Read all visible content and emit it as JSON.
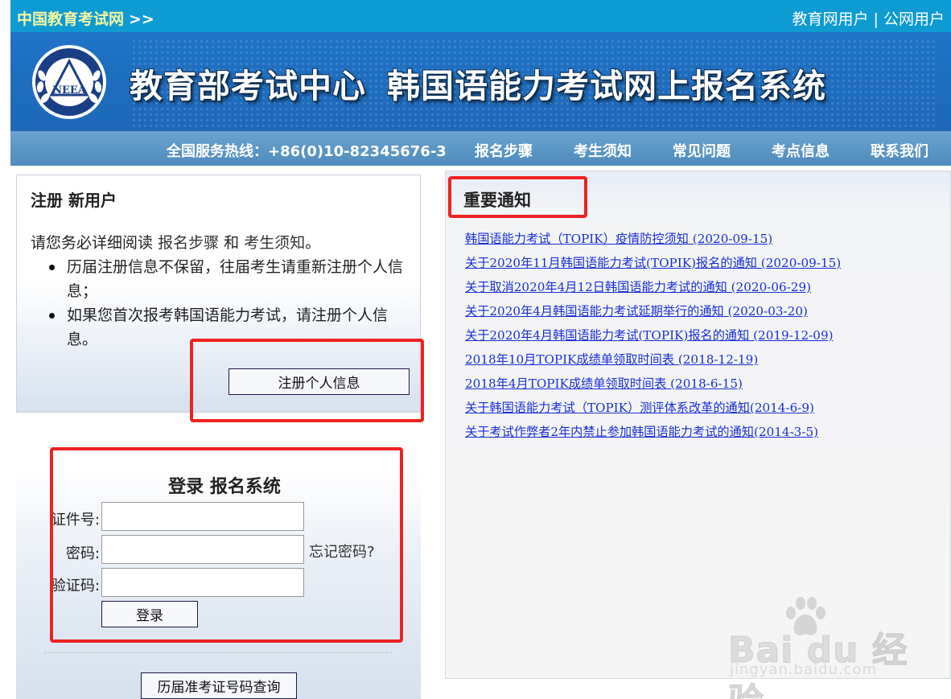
{
  "topbar": {
    "site_name": "中国教育考试网",
    "site_arrow": ">>",
    "user_link_edu": "教育网用户",
    "separator": "|",
    "user_link_public": "公网用户"
  },
  "banner": {
    "logo_text": "NEEA",
    "title_part1": "教育部考试中心",
    "title_part2": "韩国语能力考试网上报名系统"
  },
  "nav": {
    "hotline": "全国服务热线：+86(0)10-82345676-3",
    "items": [
      "报名步骤",
      "考生须知",
      "常见问题",
      "考点信息",
      "联系我们"
    ]
  },
  "register": {
    "title": "注册 新用户",
    "intro_prefix": "请您务必详细阅读",
    "link_steps": "报名步骤",
    "and": "和",
    "link_notice": "考生须知",
    "intro_suffix": "。",
    "bullets": [
      "历届注册信息不保留，往届考生请重新注册个人信息；",
      "如果您首次报考韩国语能力考试，请注册个人信息。"
    ],
    "button": "注册个人信息"
  },
  "login": {
    "title": "登录 报名系统",
    "id_label": "证件号:",
    "password_label": "密码:",
    "captcha_label": "验证码:",
    "forgot": "忘记密码?",
    "login_button": "登录",
    "history_button": "历届准考证号码查询"
  },
  "notices": {
    "title": "重要通知",
    "items": [
      "韩国语能力考试（TOPIK）疫情防控须知 (2020-09-15)",
      "关于2020年11月韩国语能力考试(TOPIK)报名的通知 (2020-09-15)",
      "关于取消2020年4月12日韩国语能力考试的通知 (2020-06-29)",
      "关于2020年4月韩国语能力考试延期举行的通知 (2020-03-20)",
      "关于2020年4月韩国语能力考试(TOPIK)报名的通知 (2019-12-09)",
      "2018年10月TOPIK成绩单领取时间表 (2018-12-19)",
      "2018年4月TOPIK成绩单领取时间表 (2018-6-15)",
      "关于韩国语能力考试（TOPIK）测评体系改革的通知(2014-6-9)",
      "关于考试作弊者2年内禁止参加韩国语能力考试的通知(2014-3-5)"
    ]
  },
  "watermark": {
    "brand": "Bai du 经验",
    "domain": "jingyan.baidu.com"
  },
  "colors": {
    "topbar": "#0e9bd2",
    "banner": "#1f73c6",
    "navbar": "#5b96c5",
    "link": "#1a2fd6",
    "highlight": "#ee2222"
  }
}
